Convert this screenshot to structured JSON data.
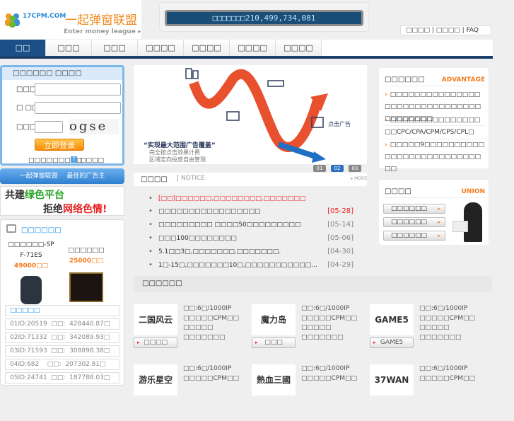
{
  "header": {
    "logo_domain": "17CPM.COM",
    "logo_cn": "一起弹窗联盟",
    "logo_en": "Enter money league ▸",
    "counter": "□□□□□□□210,499,734,081",
    "links": [
      "□□□□",
      "□□□□",
      "FAQ"
    ]
  },
  "nav": {
    "tabs": [
      "□□",
      "□□□",
      "□□□",
      "□□□□",
      "□□□□",
      "□□□□",
      "□□□□"
    ]
  },
  "login": {
    "title": "□□□□□□ □□□□",
    "username_label": "□□□□",
    "password_label": "□ □□",
    "captcha_label": "□□□□",
    "captcha_text": "ogse",
    "submit": "立即登录",
    "register_link": "□□□□□□□□□",
    "help_link": "□□□□"
  },
  "bluebar": {
    "text": "一起弹窗联盟 最佳的广告主"
  },
  "green_banner": {
    "line1a": "共建",
    "line1b": "绿色平台",
    "line2a": "拒绝",
    "line2b": "网络色情!"
  },
  "products": {
    "title": "□□□□□□",
    "items": [
      {
        "name": "□□□□□□-SPF-71ES",
        "price": "49000□□"
      },
      {
        "name": "□□□□□□",
        "price": "25000□□"
      }
    ],
    "rank_title": "□□□□□",
    "ranks": [
      "01ID:20519  □□:  428440.87□",
      "02ID:71332  □□:  342089.93□",
      "03ID:71593  □□:  308898.38□",
      "04ID:682    □□:  207302.81□",
      "05ID:24741  □□:  187788.03□"
    ]
  },
  "banner": {
    "slogan": "“实现最大范围广告覆盖”",
    "sub1": "完全按点击效果计费",
    "sub2": "区域定向投放自由管理",
    "click_label": "点击广告",
    "pages": [
      "01",
      "02",
      "03"
    ],
    "active_page": "02"
  },
  "notice": {
    "title": "□□□□",
    "en": "NOTICE",
    "more": "▸ MORE",
    "items": [
      {
        "text": "[□□]□□□□□□,□□□□□□□□,□□□□□□□",
        "date": "",
        "highlight": true
      },
      {
        "text": "□□□□□□□□□□□□□□□□□",
        "date": "[05-28]",
        "date_red": true
      },
      {
        "text": "□□□□□□□□□ □□□□50□□□□□□□□□",
        "date": "[05-14]"
      },
      {
        "text": "□□□100□□□□□□□□",
        "date": "[05-06]"
      },
      {
        "text": "5.1□□3□,□□□□□□□,□□□□□□□.",
        "date": "[04-30]"
      },
      {
        "text": "1□-15□,□□□□□□□10□,□□□□□□□□□□□...",
        "date": "[04-29]"
      }
    ]
  },
  "grid": {
    "title": "□□□□□□",
    "cards": [
      {
        "logo": "二国风云",
        "btn": "□□□□",
        "info": [
          "□□:6□/1000IP",
          "□□□□□CPM□□",
          "□□□□□",
          "□□□□□□□"
        ]
      },
      {
        "logo": "魔力岛",
        "btn": "□□□",
        "info": [
          "□□:6□/1000IP",
          "□□□□□CPM□□",
          "□□□□□",
          "□□□□□□□"
        ]
      },
      {
        "logo": "GAME5",
        "btn": "GAME5",
        "info": [
          "□□:6□/1000IP",
          "□□□□□CPM□□",
          "□□□□□",
          "□□□□□□□"
        ]
      },
      {
        "logo": "游乐星空",
        "btn": "",
        "info": [
          "□□:6□/1000IP",
          "□□□□□CPM□□"
        ]
      },
      {
        "logo": "熱血三國",
        "btn": "",
        "info": [
          "□□:6□/1000IP",
          "□□□□□CPM□□"
        ]
      },
      {
        "logo": "37WAN",
        "btn": "",
        "info": [
          "□□:6□/1000IP",
          "□□□□□CPM□□"
        ]
      }
    ]
  },
  "advantage": {
    "title": "□□□□□□",
    "en": "ADVANTAGE",
    "items": [
      "□□□□□□□□□□□□□□□□□□□□□□□□□□□□□□□□□□□□□□□",
      "□□□□□□□□□□□□□□□□□CPC/CPA/CPM/CPS/CPL□",
      "□□□□□9□□□□□□□□□□□□□□□□□□□□□□□□□□□□"
    ]
  },
  "union": {
    "title": "□□□□",
    "en": "UNION",
    "buttons": [
      "□□□□□□",
      "□□□□□□",
      "□□□□□□"
    ]
  }
}
